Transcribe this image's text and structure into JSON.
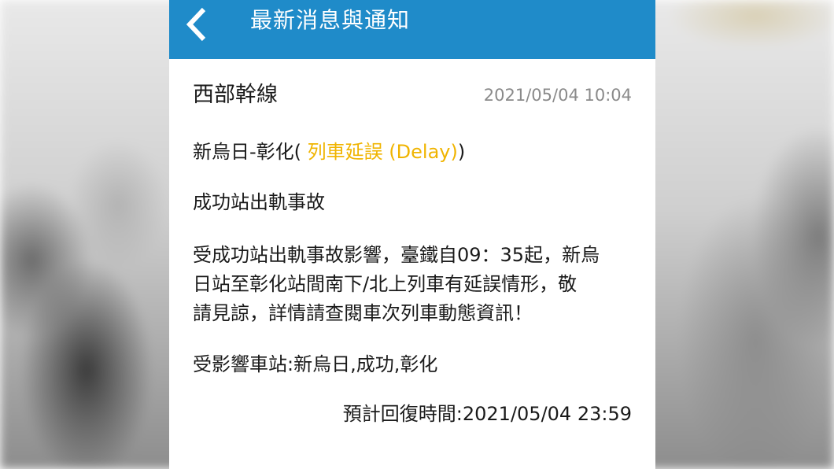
{
  "header": {
    "title": "最新消息與通知",
    "back_icon": "chevron-left-icon",
    "color": "#1f8bc9"
  },
  "notice": {
    "line_name": "西部幹線",
    "posted_time": "2021/05/04 10:04",
    "section_prefix": "新烏日-彰化(",
    "status_label": " 列車延誤 (Delay)",
    "section_suffix": ")",
    "status_color": "#f0b400",
    "incident_title": "成功站出軌事故",
    "body_lines": [
      "受成功站出軌事故影響，臺鐵自09：35起，新烏",
      "日站至彰化站間南下/北上列車有延誤情形，敬",
      "請見諒，詳情請查閱車次列車動態資訊！"
    ],
    "affected_stations": "受影響車站:新烏日,成功,彰化",
    "estimated_recovery": "預計回復時間:2021/05/04 23:59"
  }
}
